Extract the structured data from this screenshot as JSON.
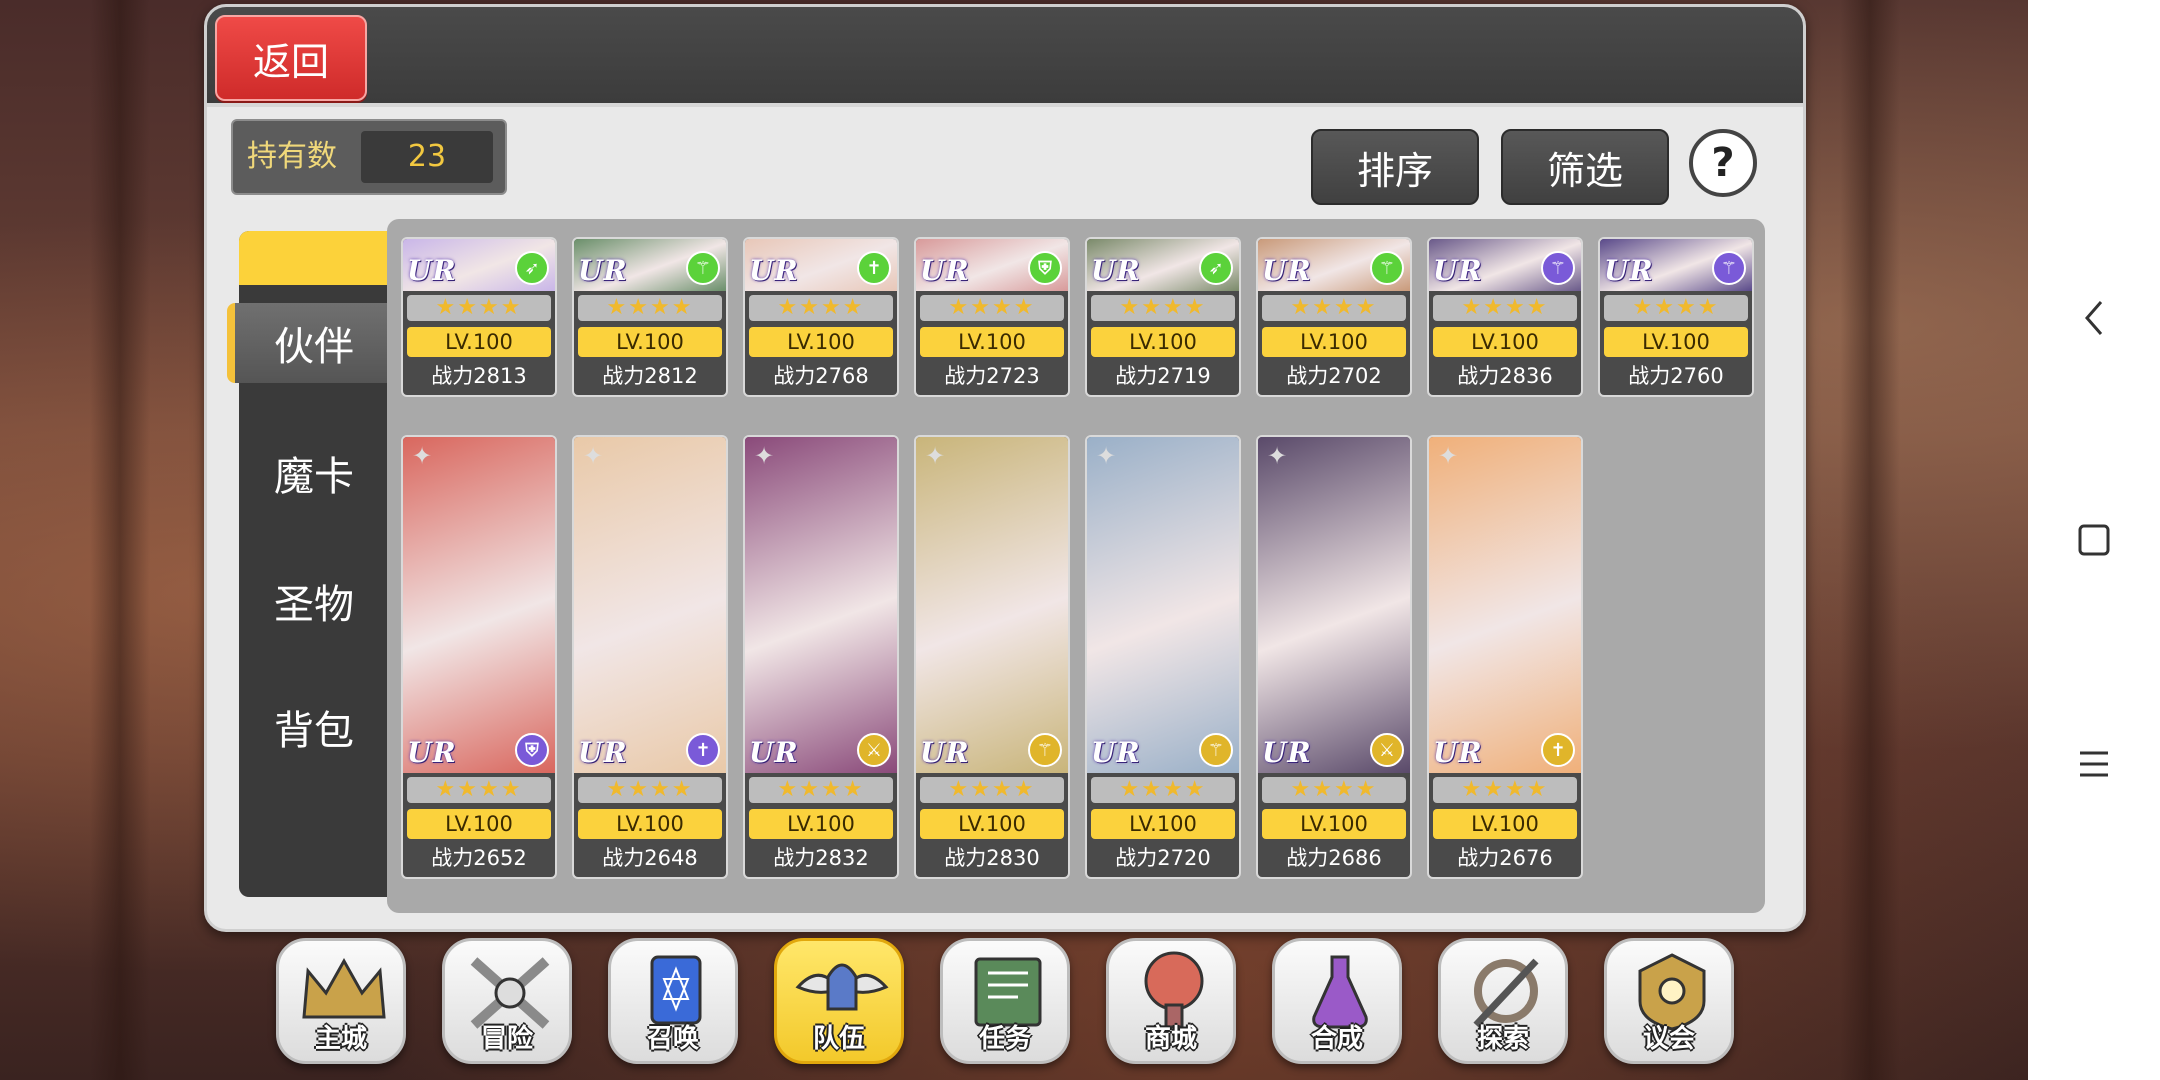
{
  "header": {
    "back_label": "返回"
  },
  "owned": {
    "label": "持有数",
    "value": "23"
  },
  "toolbar": {
    "sort_label": "排序",
    "filter_label": "筛选",
    "help_label": "?"
  },
  "side_tabs": [
    {
      "label": "伙伴",
      "active": true
    },
    {
      "label": "魔卡",
      "active": false
    },
    {
      "label": "圣物",
      "active": false
    },
    {
      "label": "背包",
      "active": false
    }
  ],
  "cards_row1": [
    {
      "rarity": "UR",
      "stars": "★★★★",
      "level": "LV.100",
      "power": "战力2813",
      "class_color": "#5bd23a",
      "class_icon": "bow-icon",
      "art_color": "#c9b6e8"
    },
    {
      "rarity": "UR",
      "stars": "★★★★",
      "level": "LV.100",
      "power": "战力2812",
      "class_color": "#5bd23a",
      "class_icon": "staff-icon",
      "art_color": "#6a8f6a"
    },
    {
      "rarity": "UR",
      "stars": "★★★★",
      "level": "LV.100",
      "power": "战力2768",
      "class_color": "#5bd23a",
      "class_icon": "cross-icon",
      "art_color": "#e8c7b8"
    },
    {
      "rarity": "UR",
      "stars": "★★★★",
      "level": "LV.100",
      "power": "战力2723",
      "class_color": "#5bd23a",
      "class_icon": "shield-icon",
      "art_color": "#d89a9a"
    },
    {
      "rarity": "UR",
      "stars": "★★★★",
      "level": "LV.100",
      "power": "战力2719",
      "class_color": "#5bd23a",
      "class_icon": "bow-icon",
      "art_color": "#7a8a6a"
    },
    {
      "rarity": "UR",
      "stars": "★★★★",
      "level": "LV.100",
      "power": "战力2702",
      "class_color": "#5bd23a",
      "class_icon": "staff-icon",
      "art_color": "#c99a7a"
    },
    {
      "rarity": "UR",
      "stars": "★★★★",
      "level": "LV.100",
      "power": "战力2836",
      "class_color": "#7a5ad8",
      "class_icon": "staff-icon",
      "art_color": "#6a5a8a"
    },
    {
      "rarity": "UR",
      "stars": "★★★★",
      "level": "LV.100",
      "power": "战力2760",
      "class_color": "#7a5ad8",
      "class_icon": "staff-icon",
      "art_color": "#5a4a8a"
    }
  ],
  "cards_row2": [
    {
      "rarity": "UR",
      "stars": "★★★★",
      "level": "LV.100",
      "power": "战力2652",
      "class_color": "#7a5ad8",
      "class_icon": "shield-icon",
      "art_color": "#d9675e"
    },
    {
      "rarity": "UR",
      "stars": "★★★★",
      "level": "LV.100",
      "power": "战力2648",
      "class_color": "#7a5ad8",
      "class_icon": "cross-icon",
      "art_color": "#e9c9a8"
    },
    {
      "rarity": "UR",
      "stars": "★★★★",
      "level": "LV.100",
      "power": "战力2832",
      "class_color": "#e0b52a",
      "class_icon": "sword-icon",
      "art_color": "#8a4a7a"
    },
    {
      "rarity": "UR",
      "stars": "★★★★",
      "level": "LV.100",
      "power": "战力2830",
      "class_color": "#e0b52a",
      "class_icon": "staff-icon",
      "art_color": "#c9b57a"
    },
    {
      "rarity": "UR",
      "stars": "★★★★",
      "level": "LV.100",
      "power": "战力2720",
      "class_color": "#e0b52a",
      "class_icon": "staff-icon",
      "art_color": "#9ab0c8"
    },
    {
      "rarity": "UR",
      "stars": "★★★★",
      "level": "LV.100",
      "power": "战力2686",
      "class_color": "#e0b52a",
      "class_icon": "sword-icon",
      "art_color": "#5a4a6a"
    },
    {
      "rarity": "UR",
      "stars": "★★★★",
      "level": "LV.100",
      "power": "战力2676",
      "class_color": "#e0b52a",
      "class_icon": "cross-icon",
      "art_color": "#f0b07a"
    }
  ],
  "dock": [
    {
      "label": "主城",
      "icon": "crown-icon",
      "active": false,
      "color": "#c9a24a"
    },
    {
      "label": "冒险",
      "icon": "crossed-swords-icon",
      "active": false,
      "color": "#8a8a8a"
    },
    {
      "label": "召唤",
      "icon": "summon-card-icon",
      "active": false,
      "color": "#3a6ad8"
    },
    {
      "label": "队伍",
      "icon": "winged-helmet-icon",
      "active": true,
      "color": "#5a7ac8"
    },
    {
      "label": "任务",
      "icon": "book-icon",
      "active": false,
      "color": "#5a8a5a"
    },
    {
      "label": "商城",
      "icon": "shop-tree-icon",
      "active": false,
      "color": "#d86a5a"
    },
    {
      "label": "合成",
      "icon": "potion-icon",
      "active": false,
      "color": "#9a5ac8"
    },
    {
      "label": "探索",
      "icon": "compass-pickaxe-icon",
      "active": false,
      "color": "#8a7a6a"
    },
    {
      "label": "议会",
      "icon": "council-emblem-icon",
      "active": false,
      "color": "#c9a24a"
    }
  ]
}
